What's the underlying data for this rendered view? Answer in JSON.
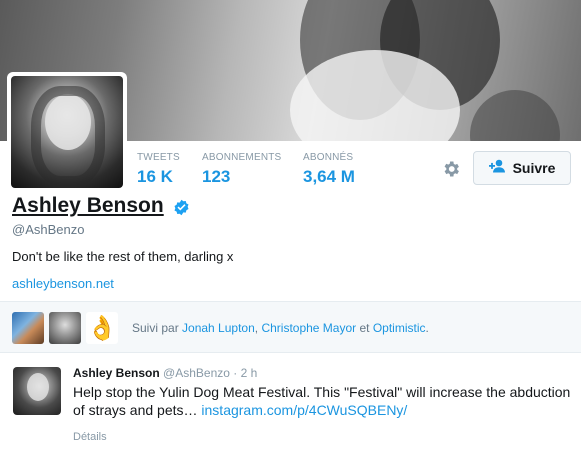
{
  "profile": {
    "name": "Ashley Benson",
    "handle": "@AshBenzo",
    "bio": "Don't be like the rest of them, darling x",
    "website": "ashleybenson.net",
    "verified": true
  },
  "stats": [
    {
      "label": "TWEETS",
      "value": "16 K"
    },
    {
      "label": "ABONNEMENTS",
      "value": "123"
    },
    {
      "label": "ABONNÉS",
      "value": "3,64 M"
    }
  ],
  "actions": {
    "follow_label": "Suivre",
    "settings_icon": "gear-icon",
    "follow_icon": "add-user-icon"
  },
  "followed_by": {
    "prefix": "Suivi par ",
    "names": [
      "Jonah Lupton",
      "Christophe Mayor",
      "Optimistic"
    ],
    "sep1": ", ",
    "sep2": " et ",
    "suffix": "."
  },
  "tweet": {
    "author": "Ashley Benson",
    "handle": "@AshBenzo",
    "sep": " · ",
    "time": "2 h",
    "text": "Help stop the Yulin Dog Meat Festival. This \"Festival\" will increase the abduction of strays and pets… ",
    "link": "instagram.com/p/4CWuSQBENy/",
    "details_label": "Détails"
  },
  "colors": {
    "accent": "#1b95e0",
    "verified": "#1da1f2",
    "muted": "#8899a6"
  }
}
